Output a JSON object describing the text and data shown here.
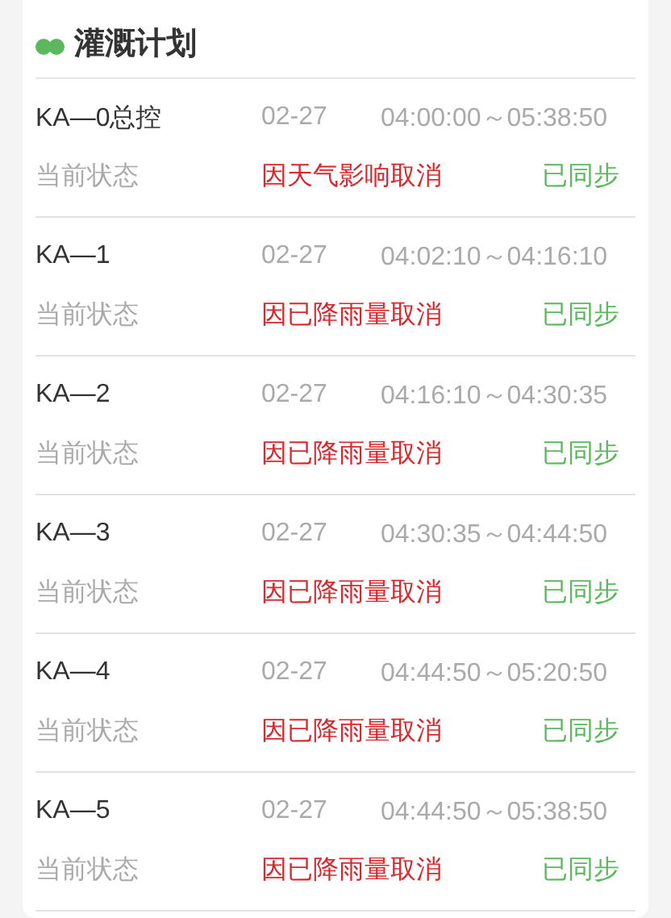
{
  "title": "灌溉计划",
  "plans": [
    {
      "name": "KA—0总控",
      "date": "02-27",
      "time": "04:00:00～05:38:50",
      "status_label": "当前状态",
      "status": "因天气影响取消",
      "sync": "已同步"
    },
    {
      "name": "KA—1",
      "date": "02-27",
      "time": "04:02:10～04:16:10",
      "status_label": "当前状态",
      "status": "因已降雨量取消",
      "sync": "已同步"
    },
    {
      "name": "KA—2",
      "date": "02-27",
      "time": "04:16:10～04:30:35",
      "status_label": "当前状态",
      "status": "因已降雨量取消",
      "sync": "已同步"
    },
    {
      "name": "KA—3",
      "date": "02-27",
      "time": "04:30:35～04:44:50",
      "status_label": "当前状态",
      "status": "因已降雨量取消",
      "sync": "已同步"
    },
    {
      "name": "KA—4",
      "date": "02-27",
      "time": "04:44:50～05:20:50",
      "status_label": "当前状态",
      "status": "因已降雨量取消",
      "sync": "已同步"
    },
    {
      "name": "KA—5",
      "date": "02-27",
      "time": "04:44:50～05:38:50",
      "status_label": "当前状态",
      "status": "因已降雨量取消",
      "sync": "已同步"
    }
  ]
}
